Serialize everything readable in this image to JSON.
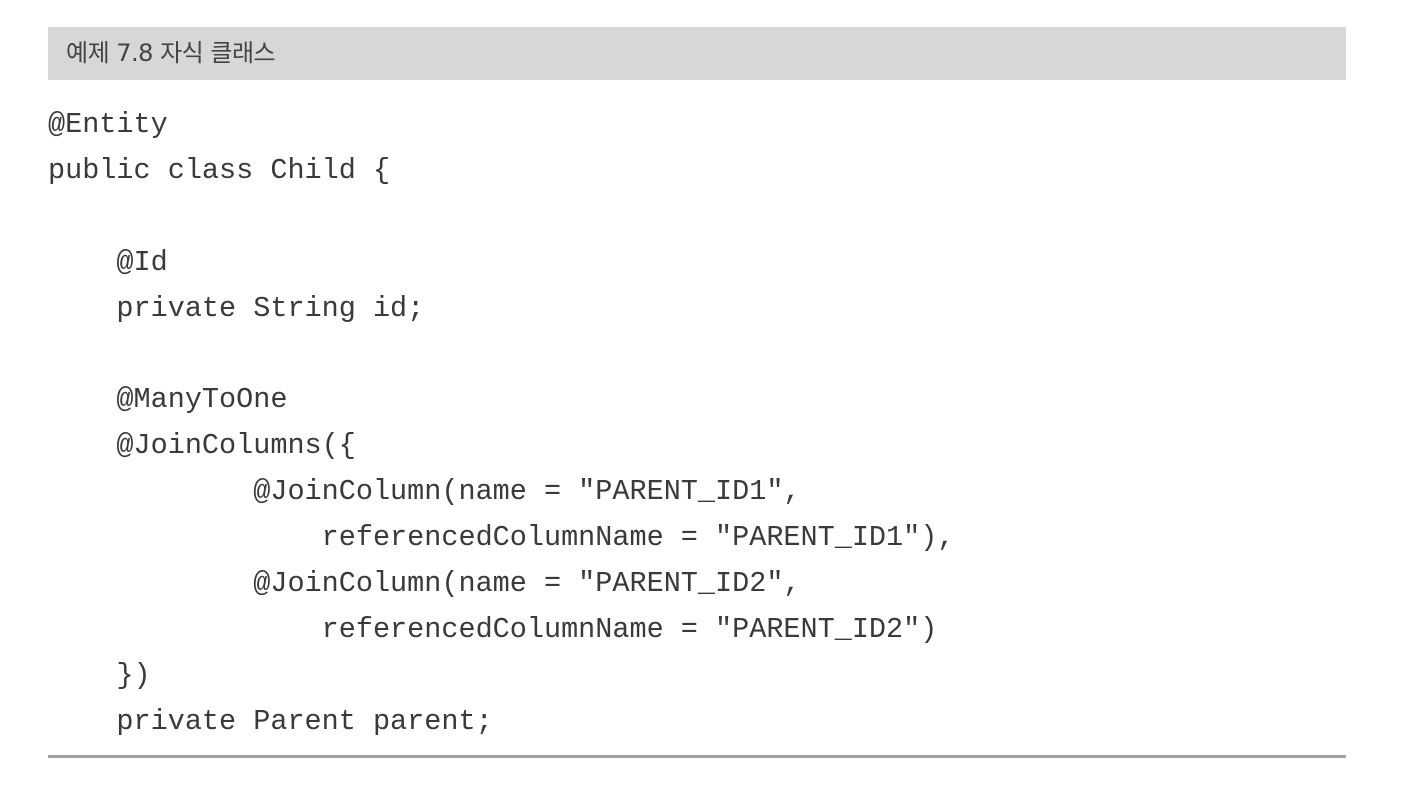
{
  "listing": {
    "title": "예제 7.8 자식 클래스",
    "code_lines": [
      "@Entity",
      "public class Child {",
      "",
      "    @Id",
      "    private String id;",
      "",
      "    @ManyToOne",
      "    @JoinColumns({",
      "            @JoinColumn(name = \"PARENT_ID1\",",
      "                referencedColumnName = \"PARENT_ID1\"),",
      "            @JoinColumn(name = \"PARENT_ID2\",",
      "                referencedColumnName = \"PARENT_ID2\")",
      "    })",
      "    private Parent parent;"
    ]
  }
}
